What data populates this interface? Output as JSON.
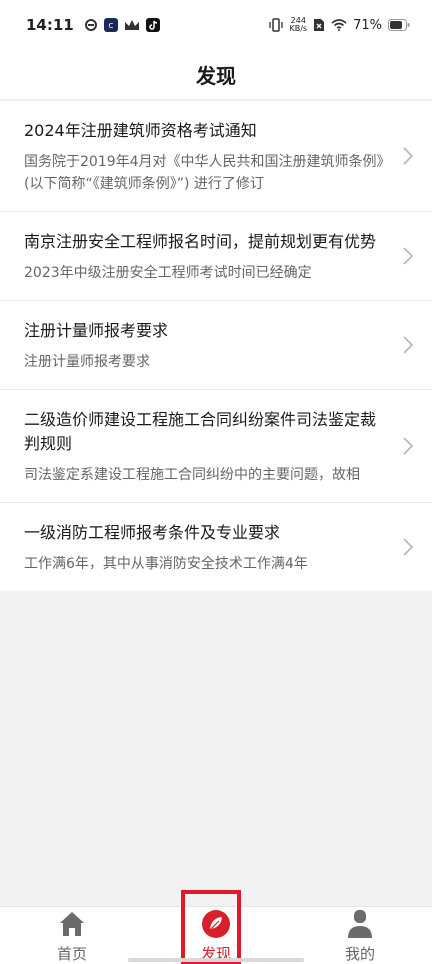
{
  "status_bar": {
    "time": "14:11",
    "net_speed_value": "244",
    "net_speed_unit": "KB/s",
    "battery_percent": "71%",
    "left_icons": [
      "sync-icon",
      "app-badge-icon",
      "crown-icon",
      "tiktok-icon"
    ],
    "right_icons": [
      "vibrate-icon",
      "sim-x-icon",
      "wifi-icon",
      "battery-icon"
    ]
  },
  "header": {
    "title": "发现"
  },
  "articles": [
    {
      "title": "2024年注册建筑师资格考试通知",
      "summary": "国务院于2019年4月对《中华人民共和国注册建筑师条例》(以下简称“《建筑师条例》”) 进行了修订"
    },
    {
      "title": "南京注册安全工程师报名时间，提前规划更有优势",
      "summary": "2023年中级注册安全工程师考试时间已经确定"
    },
    {
      "title": "注册计量师报考要求",
      "summary": "注册计量师报考要求"
    },
    {
      "title": "二级造价师建设工程施工合同纠纷案件司法鉴定裁判规则",
      "summary": "司法鉴定系建设工程施工合同纠纷中的主要问题，故相"
    },
    {
      "title": "一级消防工程师报考条件及专业要求",
      "summary": "工作满6年，其中从事消防安全技术工作满4年"
    }
  ],
  "tabs": [
    {
      "label": "首页",
      "icon": "home-icon",
      "active": false
    },
    {
      "label": "发现",
      "icon": "discover-icon",
      "active": true
    },
    {
      "label": "我的",
      "icon": "profile-icon",
      "active": false
    }
  ],
  "colors": {
    "accent": "#d6202a",
    "highlight_box": "#e0192a",
    "background": "#f2f2f2",
    "card": "#ffffff",
    "summary_text": "#666666"
  }
}
